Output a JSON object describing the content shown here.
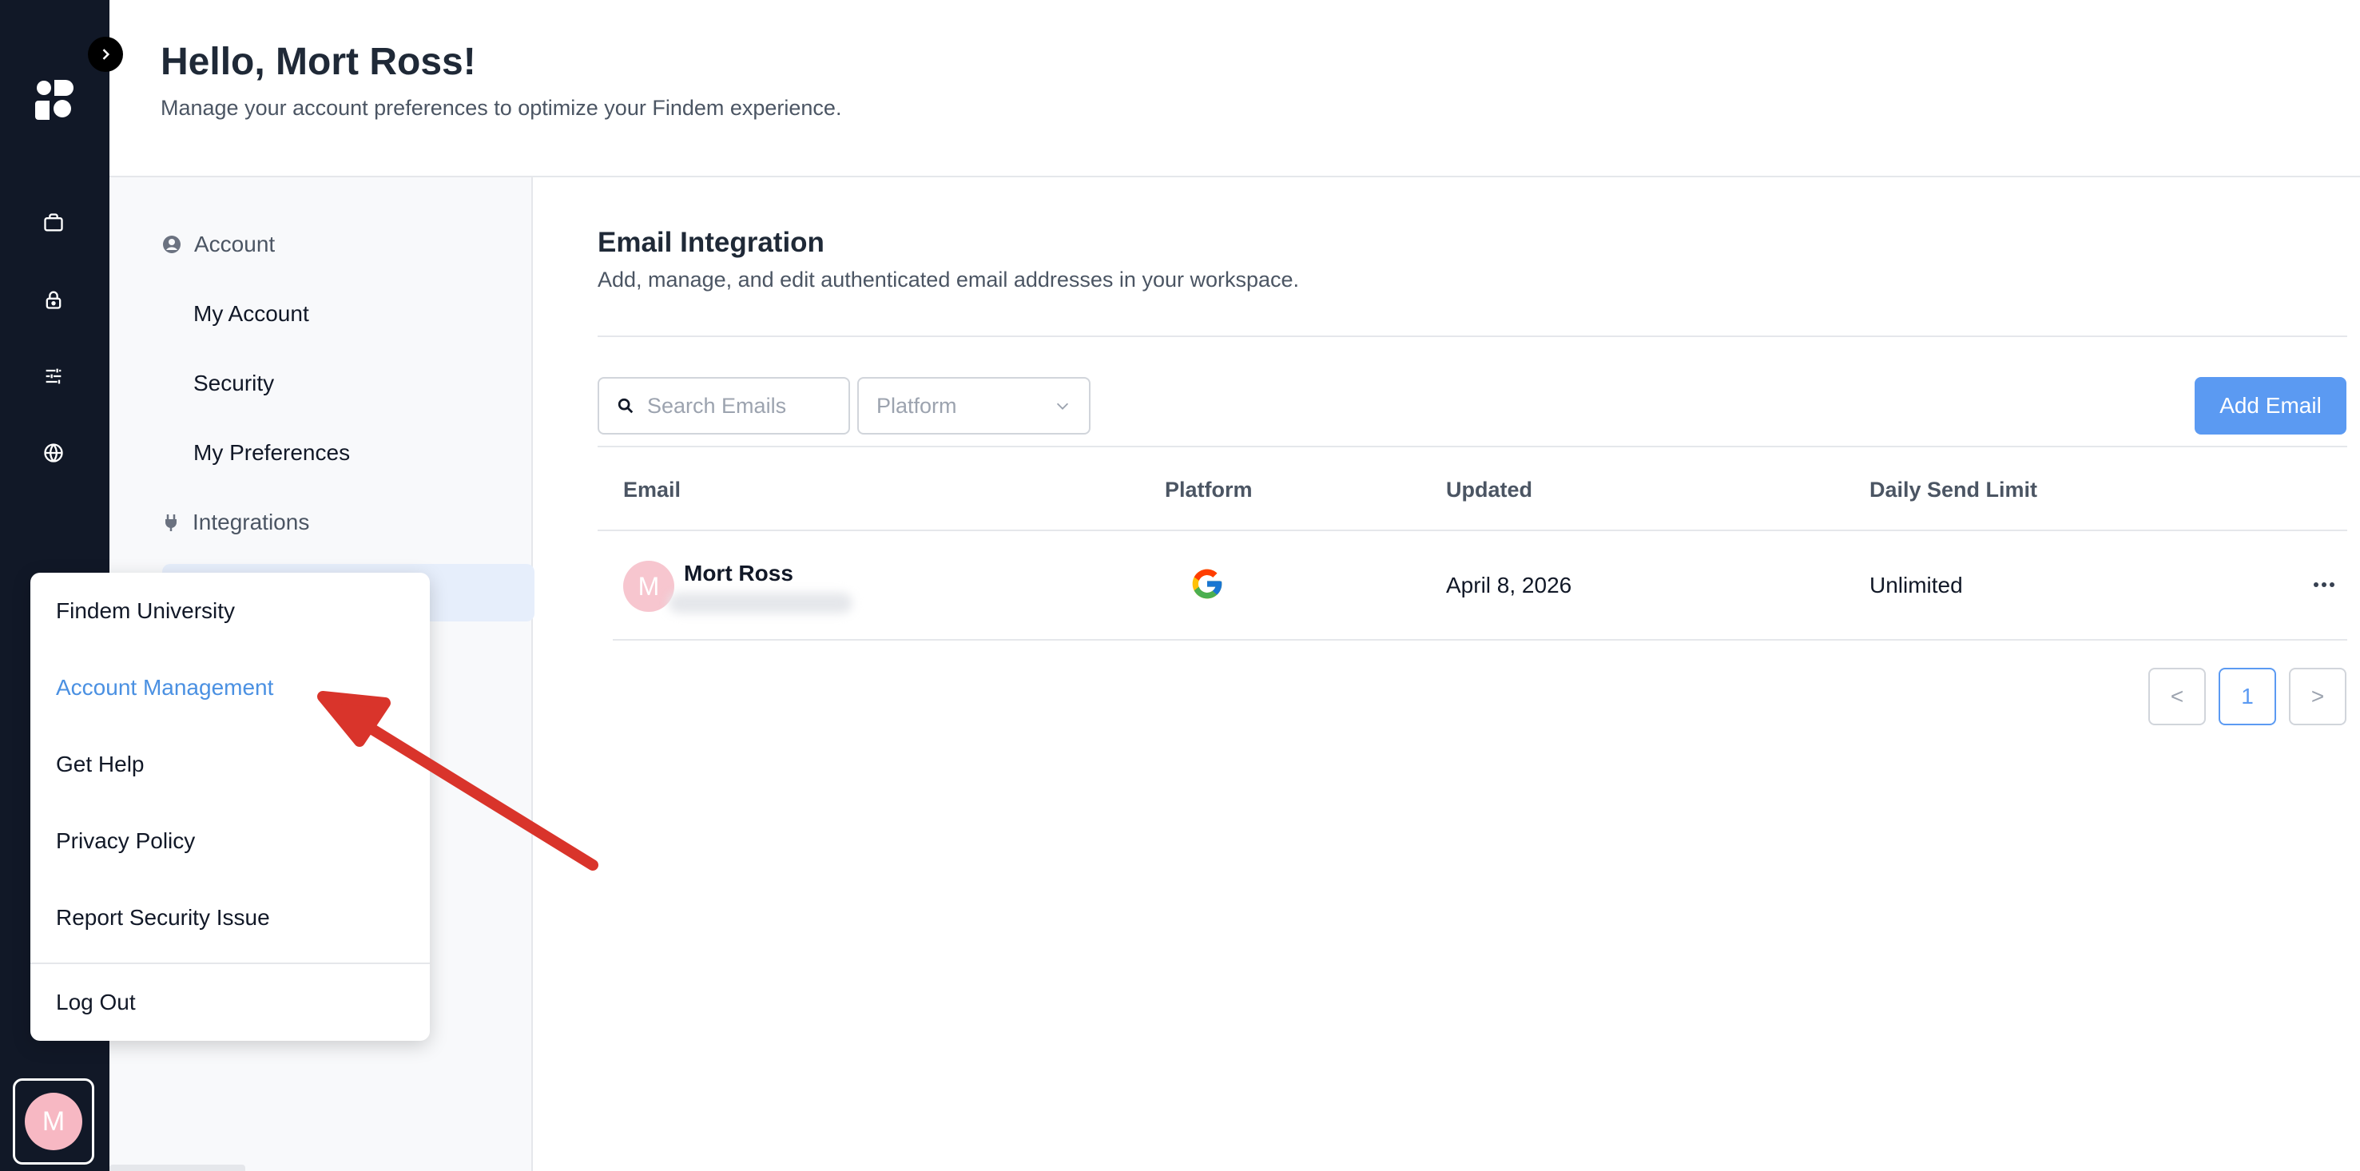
{
  "header": {
    "greeting": "Hello, Mort Ross!",
    "subtitle": "Manage your account preferences to optimize your Findem experience."
  },
  "user": {
    "initial": "M"
  },
  "settings_nav": {
    "account_group": "Account",
    "items": [
      "My Account",
      "Security",
      "My Preferences"
    ],
    "integrations_group": "Integrations"
  },
  "section": {
    "title": "Email Integration",
    "description": "Add, manage, and edit authenticated email addresses in your workspace."
  },
  "toolbar": {
    "search_placeholder": "Search Emails",
    "platform_placeholder": "Platform",
    "add_label": "Add Email"
  },
  "table": {
    "columns": [
      "Email",
      "Platform",
      "Updated",
      "Daily Send Limit"
    ],
    "rows": [
      {
        "initial": "M",
        "name": "Mort Ross",
        "platform_icon": "google-icon",
        "updated": "April 8, 2026",
        "limit": "Unlimited"
      }
    ]
  },
  "pagination": {
    "prev": "<",
    "current": "1",
    "next": ">"
  },
  "menu": {
    "items": [
      "Findem University",
      "Account Management",
      "Get Help",
      "Privacy Policy",
      "Report Security Issue"
    ],
    "logout": "Log Out"
  },
  "colors": {
    "rail": "#111827",
    "accent": "#5b9af2",
    "menu_highlight": "#4a90e2",
    "avatar": "#f7b8c3",
    "annotation_arrow": "#d9342b"
  }
}
